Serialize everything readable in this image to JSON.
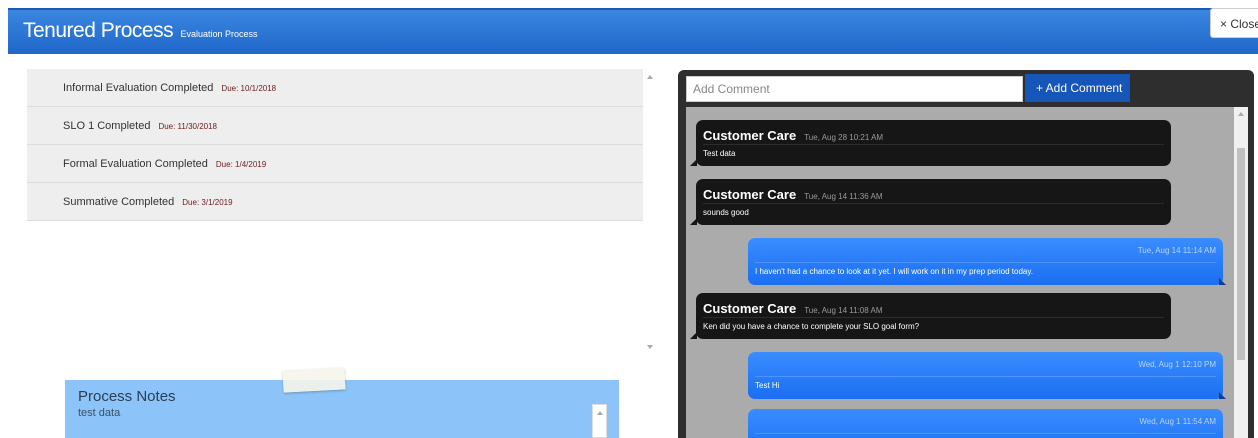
{
  "header": {
    "title": "Tenured Process",
    "subtitle": "Evaluation Process",
    "close_label": "× Close"
  },
  "tasks": [
    {
      "label": "Informal Evaluation Completed",
      "due": "Due: 10/1/2018"
    },
    {
      "label": "SLO 1 Completed",
      "due": "Due: 11/30/2018"
    },
    {
      "label": "Formal Evaluation Completed",
      "due": "Due: 1/4/2019"
    },
    {
      "label": "Summative Completed",
      "due": "Due: 3/1/2019"
    }
  ],
  "notes": {
    "title": "Process Notes",
    "text": "test data"
  },
  "chat": {
    "input_placeholder": "Add Comment",
    "add_button_label": "+ Add Comment",
    "messages": [
      {
        "type": "incoming",
        "author": "Customer Care",
        "time": "Tue, Aug 28 10:21 AM",
        "text": "Test data"
      },
      {
        "type": "incoming",
        "author": "Customer Care",
        "time": "Tue, Aug 14 11:36 AM",
        "text": "sounds good"
      },
      {
        "type": "outgoing",
        "time": "Tue, Aug 14 11:14 AM",
        "text": "I haven't had a chance to look at it yet. I will work on it in my prep period today."
      },
      {
        "type": "incoming",
        "author": "Customer Care",
        "time": "Tue, Aug 14 11:08 AM",
        "text": "Ken did you have a chance to complete your SLO goal form?"
      },
      {
        "type": "outgoing",
        "time": "Wed, Aug 1 12:10 PM",
        "text": "Test Hi"
      },
      {
        "type": "outgoing",
        "time": "Wed, Aug 1 11:54 AM",
        "text": ""
      }
    ]
  },
  "colors": {
    "header": "#2a76d6",
    "chat_dark": "#161616",
    "chat_blue": "#1b6ef0",
    "notes": "#8cc3f8"
  }
}
